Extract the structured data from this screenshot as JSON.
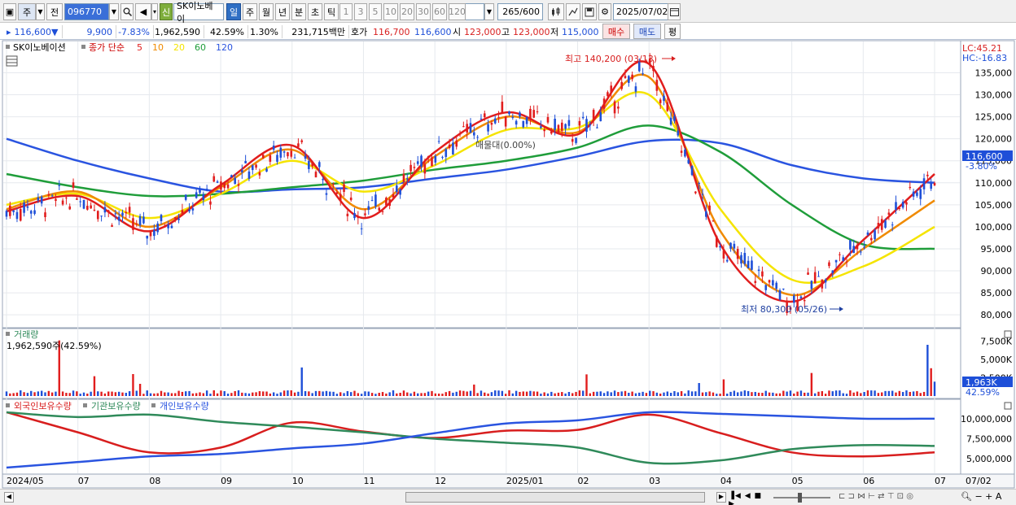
{
  "toolbar": {
    "period_week": "주",
    "prev_label": "전",
    "code": "096770",
    "new_label": "신",
    "stock_name": "SK이노베이",
    "tabs": [
      "일",
      "주",
      "월",
      "년",
      "분",
      "초",
      "틱"
    ],
    "active_tab": "일",
    "minute_opts": [
      "1",
      "3",
      "5",
      "10",
      "20",
      "30",
      "60",
      "120"
    ],
    "count": "265",
    "count_total": "/600",
    "date": "2025/07/02"
  },
  "quote": {
    "price": "116,600",
    "direction": "▼",
    "change": "9,900",
    "change_pct": "-7.83%",
    "volume": "1,962,590",
    "turnover_pct": "42.59%",
    "pct2": "1.30%",
    "amount": "231,715백만",
    "bid_label": "호가",
    "ask": "116,700",
    "bid": "116,600",
    "open_label": "시",
    "open": "123,000",
    "high_label": "고",
    "high": "123,000",
    "low_label": "저",
    "low": "115,000",
    "buy_label": "매수",
    "sell_label": "매도",
    "avg_label": "평"
  },
  "price_panel": {
    "stock": "SK이노베이션",
    "ma_title": "종가 단순",
    "ma_labels": [
      "5",
      "10",
      "20",
      "60",
      "120"
    ],
    "ma_colors": [
      "#e11d1d",
      "#f08a00",
      "#f5e400",
      "#1f9d3a",
      "#2a54e0"
    ],
    "lc": "LC:45.21",
    "hc": "HC:-16.83",
    "current_price_tag": "116,600",
    "current_pct_tag": "-3.80%",
    "high_annotation": "최고 140,200 (03/13)",
    "low_annotation": "최저 80,300 (05/26)",
    "mid_annotation": "매물대(0.00%)",
    "y_ticks": [
      "135,000",
      "130,000",
      "125,000",
      "120,000",
      "115,000",
      "110,000",
      "105,000",
      "100,000",
      "95,000",
      "90,000",
      "85,000",
      "80,000"
    ]
  },
  "volume_panel": {
    "title": "거래량",
    "value": "1,962,590주(42.59%)",
    "y_ticks": [
      "7,500K",
      "5,000K",
      "2,500K"
    ],
    "current_tag": "1,963K",
    "pct_tag": "42.59%"
  },
  "holdings_panel": {
    "series": [
      "외국인보유수량",
      "기관보유수량",
      "개인보유수량"
    ],
    "colors": [
      "#d81e1e",
      "#2f8a5a",
      "#2a54e0"
    ],
    "y_ticks": [
      "10,000,000",
      "7,500,000",
      "5,000,000"
    ]
  },
  "x_axis": [
    "2024/05",
    "07",
    "08",
    "09",
    "10",
    "11",
    "12",
    "2025/01",
    "02",
    "03",
    "04",
    "05",
    "06",
    "07"
  ],
  "x_axis_right": "07/02",
  "chart_data": {
    "type": "line",
    "title": "SK이노베이션",
    "x": [
      "2024/05",
      "07",
      "08",
      "09",
      "10",
      "11",
      "12",
      "2025/01",
      "02",
      "03",
      "04",
      "05",
      "06",
      "07"
    ],
    "series": [
      {
        "name": "5",
        "values": [
          103500,
          107000,
          99000,
          109500,
          118500,
          102000,
          117000,
          126000,
          121000,
          137000,
          96000,
          83000,
          97000,
          112000
        ]
      },
      {
        "name": "10",
        "values": [
          104000,
          108000,
          100000,
          109000,
          117500,
          104000,
          116000,
          125000,
          121500,
          134000,
          99000,
          84500,
          95000,
          106000
        ]
      },
      {
        "name": "20",
        "values": [
          105000,
          107500,
          102000,
          107500,
          115000,
          108000,
          114000,
          122000,
          122500,
          130000,
          104000,
          88000,
          91000,
          100000
        ]
      },
      {
        "name": "60",
        "values": [
          112000,
          109000,
          107000,
          107500,
          109000,
          110500,
          113000,
          115000,
          118000,
          123000,
          117000,
          105000,
          96000,
          95000
        ]
      },
      {
        "name": "120",
        "values": [
          120000,
          115000,
          111000,
          108000,
          108500,
          109000,
          111000,
          113000,
          116000,
          119500,
          119000,
          114000,
          111000,
          110000
        ]
      }
    ],
    "ylim": [
      78000,
      141000
    ],
    "volume_ylim": [
      0,
      8000000
    ],
    "holdings_ylim": [
      3500000,
      11200000
    ]
  }
}
